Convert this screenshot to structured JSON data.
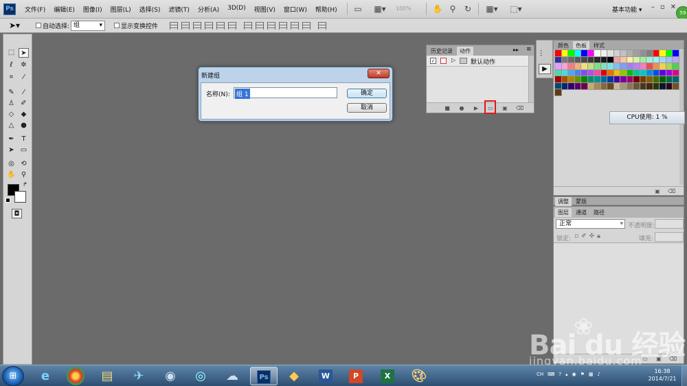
{
  "app": {
    "logo": "Ps"
  },
  "menu": {
    "items": [
      "文件(F)",
      "编辑(E)",
      "图像(I)",
      "图层(L)",
      "选择(S)",
      "滤镜(T)",
      "分析(A)",
      "3D(D)",
      "视图(V)",
      "窗口(W)",
      "帮助(H)"
    ],
    "zoom": "100%",
    "workspace": "基本功能",
    "badge": "59"
  },
  "options": {
    "auto_select_label": "自动选择:",
    "auto_select_value": "组",
    "show_transform_label": "显示变换控件"
  },
  "dialog": {
    "title": "新建组",
    "close": "✕",
    "name_label": "名称(N):",
    "name_value": "组 1",
    "ok_label": "确定",
    "cancel_label": "取消"
  },
  "actions_panel": {
    "tab_history": "历史记录",
    "tab_actions": "动作",
    "row_label": "默认动作"
  },
  "swatches_panel": {
    "tab_color": "颜色",
    "tab_swatches": "色板",
    "tab_styles": "样式",
    "colors": [
      "#ff0000",
      "#ffff00",
      "#00ff00",
      "#00ffff",
      "#0000ff",
      "#ff00ff",
      "#ffffff",
      "#f0f0f0",
      "#e0e0e0",
      "#d0d0d0",
      "#c0c0c0",
      "#b0b0b0",
      "#a0a0a0",
      "#909090",
      "#808080",
      "#ff0000",
      "#ffff00",
      "#00ff00",
      "#0000ff",
      "#2e2ea0",
      "#7a7a7a",
      "#6a6a6a",
      "#5a5a5a",
      "#4a4a4a",
      "#3a3a3a",
      "#2a2a2a",
      "#1a1a1a",
      "#000000",
      "#f5a0a0",
      "#f8c8a0",
      "#fff0a0",
      "#d8f0a0",
      "#a0f0a0",
      "#a0f0d0",
      "#a0f0f0",
      "#a0d8f8",
      "#a0c0f8",
      "#c0a0f8",
      "#e0a0f8",
      "#f8a0e0",
      "#f08080",
      "#f0b080",
      "#f0e080",
      "#c0e080",
      "#80e080",
      "#80e0c0",
      "#80e0e0",
      "#80c0f0",
      "#80a0f0",
      "#a080f0",
      "#c080f0",
      "#f080c0",
      "#e85050",
      "#ec9050",
      "#f0d050",
      "#a8d850",
      "#50d050",
      "#50d8a8",
      "#50d8d8",
      "#50a8ec",
      "#5080ec",
      "#8050ec",
      "#b050ec",
      "#ec50a8",
      "#e00000",
      "#e87000",
      "#f0c000",
      "#90c800",
      "#00c000",
      "#00c890",
      "#00c8c8",
      "#0090e0",
      "#0050e0",
      "#6000e0",
      "#a000e0",
      "#e00090",
      "#a00000",
      "#a85000",
      "#b08800",
      "#689000",
      "#008800",
      "#009068",
      "#009090",
      "#0068a0",
      "#0038a0",
      "#4800a0",
      "#7800a0",
      "#a00068",
      "#700000",
      "#783800",
      "#806000",
      "#486800",
      "#006000",
      "#006848",
      "#006868",
      "#004870",
      "#002870",
      "#320070",
      "#540070",
      "#700048",
      "#c8a878",
      "#a88858",
      "#886838",
      "#684818",
      "#c8b898",
      "#a89878",
      "#887858",
      "#685838",
      "#483818",
      "#482808",
      "#283808",
      "#081828",
      "#280818",
      "#785028",
      "#603818"
    ]
  },
  "cpu_tip": "CPU使用: 1 %",
  "adjust_tabs": {
    "tab_adjust": "调整",
    "tab_mask": "蒙版"
  },
  "layers_panel": {
    "tab_layers": "图层",
    "tab_channels": "通道",
    "tab_paths": "路径",
    "blend_mode": "正常",
    "opacity_label": "不透明度:",
    "lock_label": "锁定:",
    "fill_label": "填充:"
  },
  "taskbar": {
    "ps_label": "Ps",
    "word_label": "W",
    "ppt_label": "P",
    "excel_label": "X",
    "lang": "CH",
    "time": "16:38",
    "date": "2014/7/21"
  },
  "watermark": {
    "logo": "Bai  du 经验",
    "url": "jingyan.baidu.com"
  }
}
